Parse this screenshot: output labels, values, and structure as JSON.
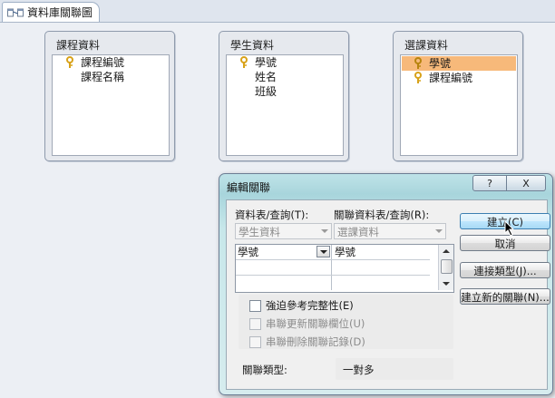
{
  "tab": {
    "title": "資料庫關聯圖",
    "icon": "relationships-icon"
  },
  "tables": [
    {
      "name": "課程資料",
      "fields": [
        {
          "label": "課程編號",
          "key": true
        },
        {
          "label": "課程名稱",
          "key": false
        }
      ]
    },
    {
      "name": "學生資料",
      "fields": [
        {
          "label": "學號",
          "key": true
        },
        {
          "label": "姓名",
          "key": false
        },
        {
          "label": "班級",
          "key": false
        }
      ]
    },
    {
      "name": "選課資料",
      "fields": [
        {
          "label": "學號",
          "key": true,
          "selected": true
        },
        {
          "label": "課程編號",
          "key": true
        }
      ]
    }
  ],
  "dialog": {
    "title": "編輯關聯",
    "help_btn": "?",
    "close_btn": "X",
    "table_query_label": "資料表/查詢(T):",
    "related_table_label": "關聯資料表/查詢(R):",
    "table_value": "學生資料",
    "related_value": "選課資料",
    "grid_left": "學號",
    "grid_right": "學號",
    "enforce_integrity": "強迫參考完整性(E)",
    "cascade_update": "串聯更新關聯欄位(U)",
    "cascade_delete": "串聯刪除關聯記錄(D)",
    "relation_type_label": "關聯類型:",
    "relation_type_value": "一對多",
    "buttons": {
      "create": "建立(C)",
      "cancel": "取消",
      "join_type": "連接類型(J)...",
      "create_new": "建立新的關聯(N)..."
    }
  },
  "colors": {
    "accent_selected": "#f7b97a",
    "dialog_frame": "#a8d5dc",
    "key_icon": "#d8a21a"
  }
}
